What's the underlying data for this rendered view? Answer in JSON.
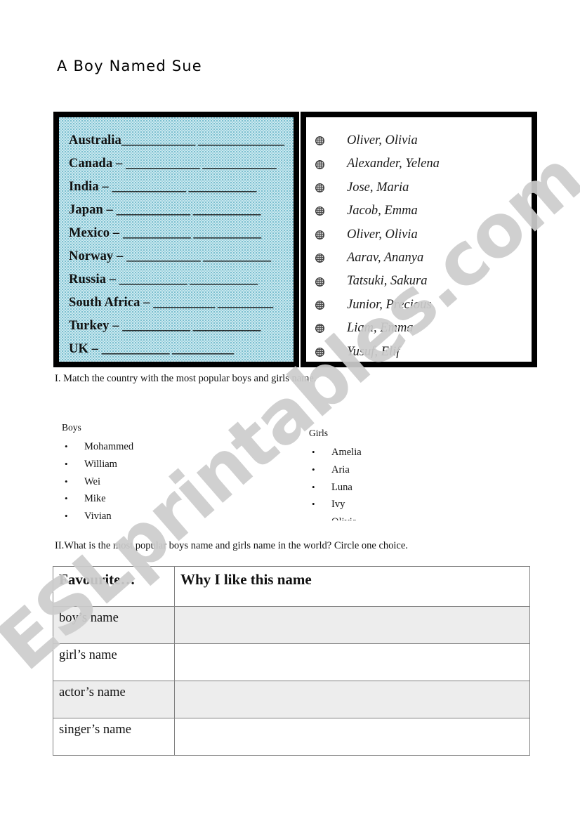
{
  "page": {
    "title": "A Boy Named Sue",
    "watermark": "ESLprintables.com"
  },
  "colors": {
    "box_border": "#000000",
    "countries_box_bg": "#cfeaf0",
    "countries_box_pattern": "#79bfd0",
    "bullet": "#4d4d4d",
    "table_border": "#808080",
    "table_shaded_row": "#ededed",
    "watermark": "#cdcdcd"
  },
  "countries_box": {
    "rows": [
      {
        "name": "Australia",
        "dash": "",
        "blanks": "____________  ______________"
      },
      {
        "name": "Canada",
        "dash": " – ",
        "blanks": "____________ ____________"
      },
      {
        "name": "India",
        "dash": " – ",
        "blanks": "____________ ___________"
      },
      {
        "name": "Japan",
        "dash": " – ",
        "blanks": "____________ ___________"
      },
      {
        "name": "Mexico",
        "dash": " – ",
        "blanks": "___________ ___________"
      },
      {
        "name": "Norway",
        "dash": " – ",
        "blanks": "____________ ___________"
      },
      {
        "name": "Russia",
        "dash": " – ",
        "blanks": "___________ ___________"
      },
      {
        "name": "South Africa",
        "dash": " – ",
        "blanks": "__________ _________"
      },
      {
        "name": "Turkey",
        "dash": " – ",
        "blanks": "___________ ___________"
      },
      {
        "name": "UK",
        "dash": " – ",
        "blanks": "___________ __________"
      }
    ]
  },
  "names_box": {
    "items": [
      "Oliver, Olivia",
      "Alexander, Yelena",
      "Jose, Maria",
      "Jacob, Emma",
      "Oliver, Olivia",
      "Aarav, Ananya",
      "Tatsuki, Sakura",
      "Junior, Precious",
      "Liam, Emma",
      "Yusuf, Elif"
    ]
  },
  "instructions": {
    "one": "I.  Match the country with the most popular boys and girls name.",
    "two": "II.What is the most popular boys name and girls name in the world? Circle one choice."
  },
  "boys_list": {
    "heading": "Boys",
    "items": [
      "Mohammed",
      "William",
      "Wei",
      "Mike",
      "Vivian"
    ]
  },
  "girls_list": {
    "heading": "Girls",
    "items": [
      "Amelia",
      "Aria",
      "Luna",
      "Ivy",
      "Olivia"
    ]
  },
  "favourite_table": {
    "headers": [
      "Favourite…",
      "Why I like this name"
    ],
    "rows": [
      {
        "label": "boy’s name",
        "why": ""
      },
      {
        "label": "girl’s name",
        "why": ""
      },
      {
        "label": "actor’s name",
        "why": ""
      },
      {
        "label": "singer’s name",
        "why": ""
      }
    ]
  }
}
